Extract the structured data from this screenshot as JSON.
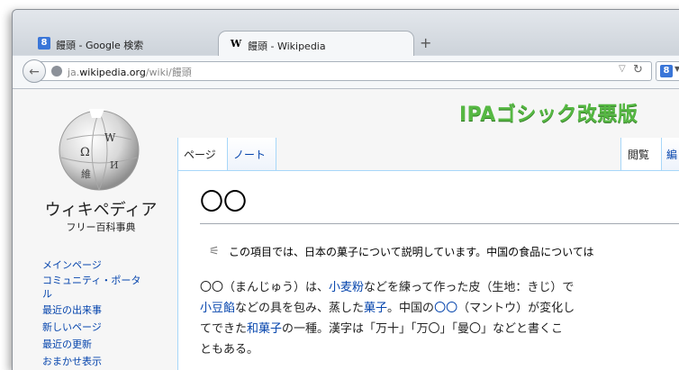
{
  "tabs": [
    {
      "favicon": "8",
      "title": "饅頭 - Google 検索"
    },
    {
      "favicon": "W",
      "title": "饅頭 - Wikipedia"
    }
  ],
  "new_tab": "+",
  "url": {
    "prefix": "ja.",
    "domain": "wikipedia.org",
    "path": "/wiki/饅頭"
  },
  "search_favicon": "8",
  "site": {
    "name": "ウィキペディア",
    "tagline": "フリー百科事典"
  },
  "logo_glyphs": [
    "Ω",
    "W",
    "維",
    "И"
  ],
  "sidebar": {
    "items": [
      "メインページ",
      "コミュニティ・ポータ",
      "ル",
      "最近の出来事",
      "新しいページ",
      "最近の更新",
      "おまかせ表示"
    ]
  },
  "overlay_caption": "IPAゴシック改悪版",
  "content_tabs": {
    "page": "ページ",
    "note": "ノート",
    "read": "閲覧",
    "edit": "編"
  },
  "article": {
    "title": "〇〇",
    "hatnote": "この項目では、日本の菓子について説明しています。中国の食品については",
    "lines": [
      [
        {
          "t": "〇〇（まんじゅう）は、"
        },
        {
          "t": "小麦粉",
          "link": true
        },
        {
          "t": "などを練って作った皮（生地：きじ）で"
        }
      ],
      [
        {
          "t": "小豆餡",
          "link": true
        },
        {
          "t": "などの具を包み、蒸した"
        },
        {
          "t": "菓子",
          "link": true
        },
        {
          "t": "。中国の"
        },
        {
          "t": "〇〇",
          "link": true
        },
        {
          "t": "（マントウ）が変化し"
        }
      ],
      [
        {
          "t": "てできた"
        },
        {
          "t": "和菓子",
          "link": true
        },
        {
          "t": "の一種。漢字は「万十」「万〇」「曼〇」などと書くこ"
        }
      ],
      [
        {
          "t": "ともある。"
        }
      ]
    ]
  },
  "colors": {
    "link": "#0645ad",
    "caption": "#56b843",
    "tab_border": "#a7d7f9"
  }
}
